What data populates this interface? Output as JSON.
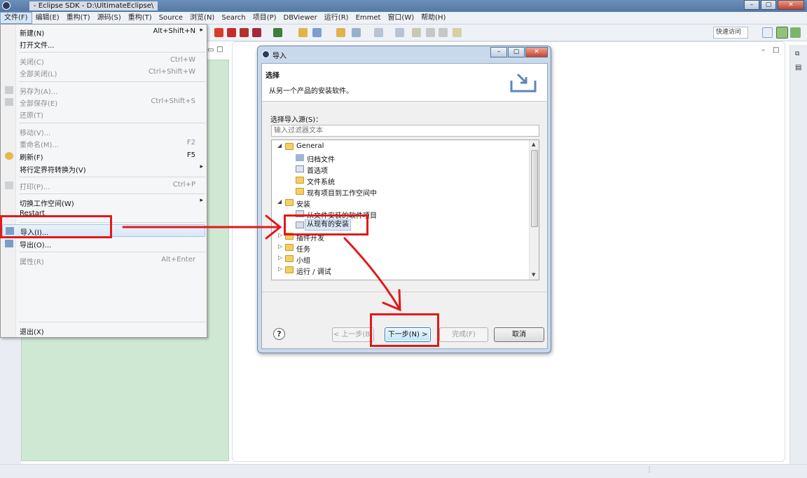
{
  "window": {
    "title": "  -  Eclipse SDK  -  D:\\UltimateEclipse\\"
  },
  "menubar": [
    {
      "id": "file",
      "label": "文件(F)"
    },
    {
      "id": "edit",
      "label": "编辑(E)"
    },
    {
      "id": "refactor1",
      "label": "重构(T)"
    },
    {
      "id": "source-cn",
      "label": "源码(S)"
    },
    {
      "id": "refactor2",
      "label": "重构(T)"
    },
    {
      "id": "source",
      "label": "Source"
    },
    {
      "id": "navigate",
      "label": "浏览(N)"
    },
    {
      "id": "search",
      "label": "Search"
    },
    {
      "id": "project",
      "label": "项目(P)"
    },
    {
      "id": "dbviewer",
      "label": "DBViewer"
    },
    {
      "id": "run",
      "label": "运行(R)"
    },
    {
      "id": "emmet",
      "label": "Emmet"
    },
    {
      "id": "window",
      "label": "窗口(W)"
    },
    {
      "id": "help",
      "label": "帮助(H)"
    }
  ],
  "toolbar": {
    "quick_access": "快速访问"
  },
  "file_menu": {
    "items": [
      {
        "label": "新建(N)",
        "shortcut": "Alt+Shift+N",
        "submenu": true,
        "disabled": false
      },
      {
        "label": "打开文件...",
        "shortcut": "",
        "submenu": false,
        "disabled": false
      },
      {
        "label": "关闭(C)",
        "shortcut": "Ctrl+W",
        "submenu": false,
        "disabled": true
      },
      {
        "label": "全部关闭(L)",
        "shortcut": "Ctrl+Shift+W",
        "submenu": false,
        "disabled": true
      },
      {
        "label": "另存为(A)...",
        "shortcut": "",
        "submenu": false,
        "disabled": true
      },
      {
        "label": "全部保存(E)",
        "shortcut": "Ctrl+Shift+S",
        "submenu": false,
        "disabled": true
      },
      {
        "label": "还原(T)",
        "shortcut": "",
        "submenu": false,
        "disabled": true
      },
      {
        "label": "移动(V)...",
        "shortcut": "",
        "submenu": false,
        "disabled": true
      },
      {
        "label": "重命名(M)...",
        "shortcut": "F2",
        "submenu": false,
        "disabled": true
      },
      {
        "label": "刷新(F)",
        "shortcut": "F5",
        "submenu": false,
        "disabled": false
      },
      {
        "label": "将行定界符转换为(V)",
        "shortcut": "",
        "submenu": true,
        "disabled": false
      },
      {
        "label": "打印(P)...",
        "shortcut": "Ctrl+P",
        "submenu": false,
        "disabled": true
      },
      {
        "label": "切换工作空间(W)",
        "shortcut": "",
        "submenu": true,
        "disabled": false
      },
      {
        "label": "Restart",
        "shortcut": "",
        "submenu": false,
        "disabled": false
      },
      {
        "label": "导入(I)...",
        "shortcut": "",
        "submenu": false,
        "disabled": false,
        "highlighted": true
      },
      {
        "label": "导出(O)...",
        "shortcut": "",
        "submenu": false,
        "disabled": false
      },
      {
        "label": "属性(R)",
        "shortcut": "Alt+Enter",
        "submenu": false,
        "disabled": true
      },
      {
        "label": "退出(X)",
        "shortcut": "",
        "submenu": false,
        "disabled": false
      }
    ]
  },
  "dialog": {
    "title": "导入",
    "heading": "选择",
    "description": "从另一个产品的安装软件。",
    "source_label": "选择导入源(S)：",
    "filter_placeholder": "输入过滤器文本",
    "tree": [
      {
        "label": "General",
        "type": "folder",
        "expanded": true,
        "level": 0
      },
      {
        "label": "归档文件",
        "type": "item",
        "level": 1
      },
      {
        "label": "首选项",
        "type": "item",
        "level": 1
      },
      {
        "label": "文件系统",
        "type": "folder",
        "level": 1
      },
      {
        "label": "现有项目到工作空间中",
        "type": "item",
        "level": 1
      },
      {
        "label": "安装",
        "type": "folder",
        "expanded": true,
        "level": 0
      },
      {
        "label": "从文件安装的软件项目",
        "type": "item",
        "level": 1
      },
      {
        "label": "从现有的安装",
        "type": "item",
        "level": 1,
        "selected": true
      },
      {
        "label": "插件开发",
        "type": "folder",
        "expanded": false,
        "level": 0
      },
      {
        "label": "任务",
        "type": "folder",
        "expanded": false,
        "level": 0
      },
      {
        "label": "小组",
        "type": "folder",
        "expanded": false,
        "level": 0
      },
      {
        "label": "运行 / 调试",
        "type": "folder",
        "expanded": false,
        "level": 0
      }
    ],
    "help_label": "?",
    "buttons": {
      "back": "< 上一步(B)",
      "next": "下一步(N) >",
      "finish": "完成(F)",
      "cancel": "取消"
    }
  },
  "annotation_color": "#e01a1a"
}
